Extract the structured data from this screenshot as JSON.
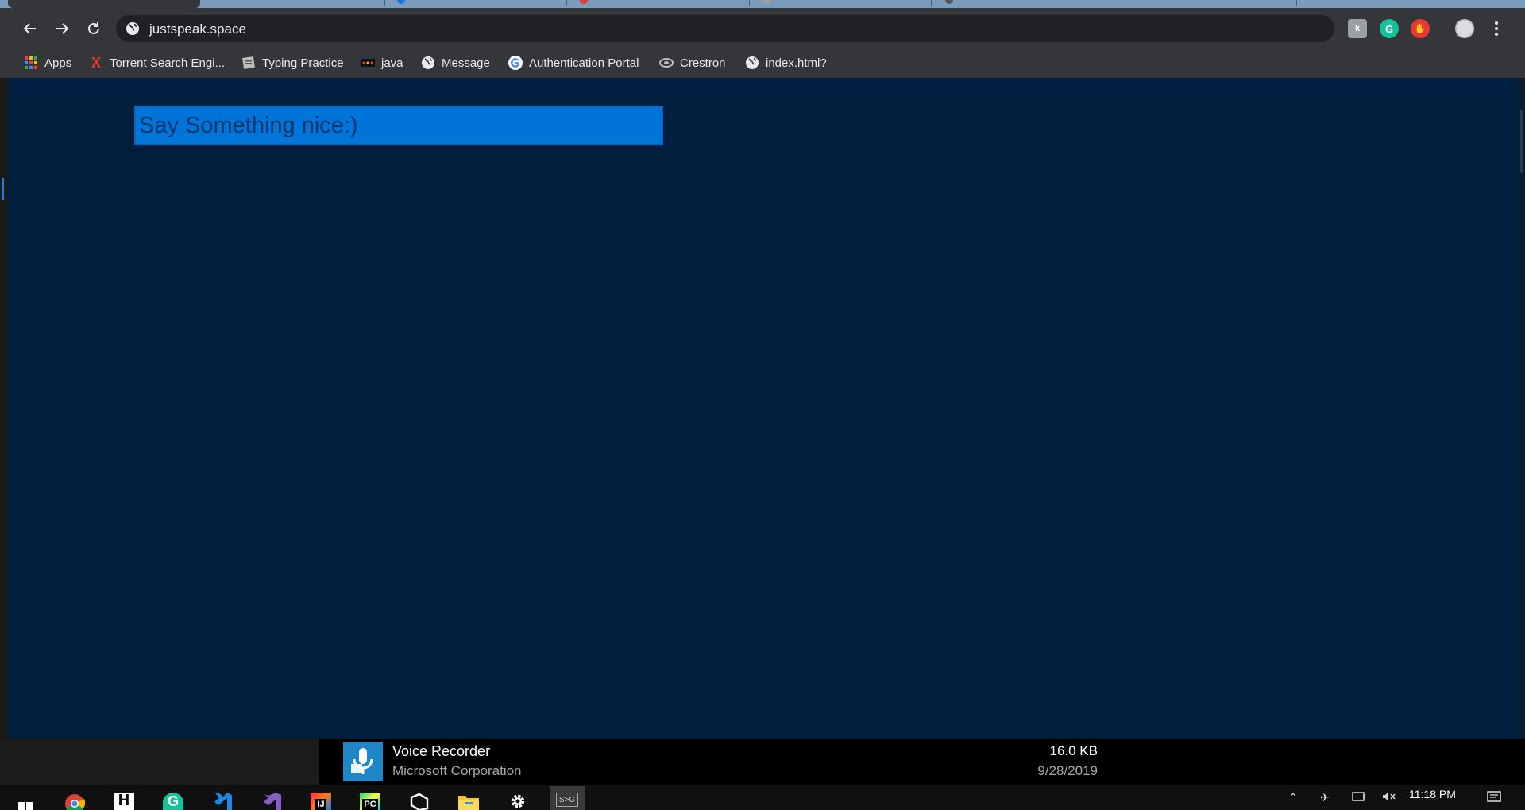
{
  "browser": {
    "url": "justspeak.space",
    "bookmarks": [
      {
        "label": "Apps",
        "icon": "apps-grid-icon"
      },
      {
        "label": "Torrent Search Engi...",
        "icon": "torrent-x-icon"
      },
      {
        "label": "Typing Practice",
        "icon": "typing-practice-icon"
      },
      {
        "label": "java",
        "icon": "java-icon"
      },
      {
        "label": "Message",
        "icon": "globe-icon"
      },
      {
        "label": "Authentication Portal",
        "icon": "google-icon"
      },
      {
        "label": "Crestron",
        "icon": "crestron-icon"
      },
      {
        "label": "index.html?",
        "icon": "globe-icon"
      }
    ]
  },
  "page": {
    "input_placeholder": "Say Something nice:)",
    "background_color": "#001e3e",
    "input_color": "#0074d9"
  },
  "notification": {
    "app_name": "Voice Recorder",
    "publisher": "Microsoft Corporation",
    "size": "16.0 KB",
    "date": "9/28/2019"
  },
  "taskbar": {
    "clock": "11:18 PM"
  }
}
